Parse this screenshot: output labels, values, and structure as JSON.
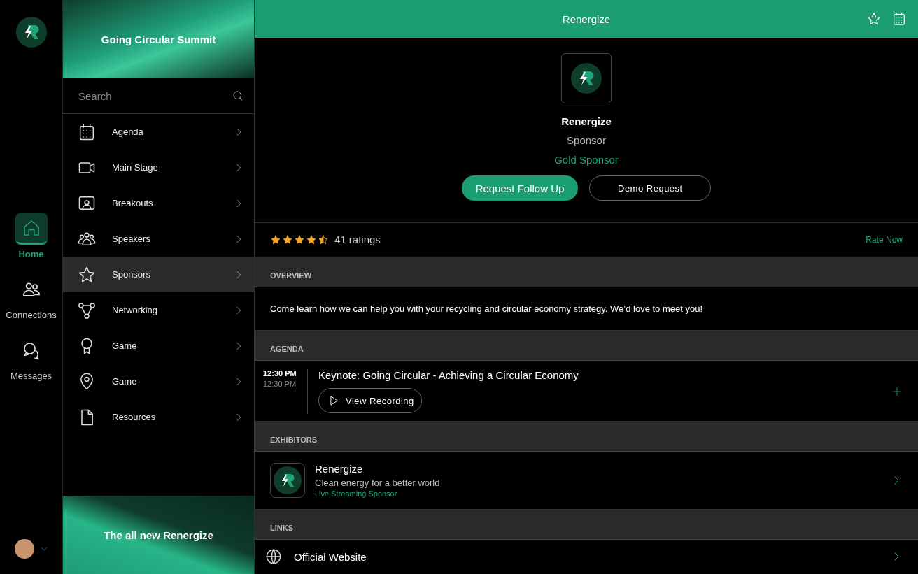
{
  "rail": {
    "items": [
      {
        "label": "Home",
        "kind": "home",
        "selected": true
      },
      {
        "label": "Connections",
        "kind": "people",
        "selected": false
      },
      {
        "label": "Messages",
        "kind": "chat",
        "selected": false
      }
    ]
  },
  "menu": {
    "banner_title": "Going Circular Summit",
    "search": {
      "placeholder": "Search"
    },
    "items": [
      {
        "label": "Agenda",
        "kind": "calendar",
        "selected": false
      },
      {
        "label": "Main Stage",
        "kind": "video",
        "selected": false
      },
      {
        "label": "Breakouts",
        "kind": "screen",
        "selected": false
      },
      {
        "label": "Speakers",
        "kind": "group",
        "selected": false
      },
      {
        "label": "Sponsors",
        "kind": "star",
        "selected": true
      },
      {
        "label": "Networking",
        "kind": "network",
        "selected": false
      },
      {
        "label": "Game",
        "kind": "medal",
        "selected": false
      },
      {
        "label": "Game",
        "kind": "pin",
        "selected": false
      },
      {
        "label": "Resources",
        "kind": "file",
        "selected": false
      }
    ],
    "footer_title": "The all new Renergize"
  },
  "header": {
    "title": "Renergize"
  },
  "sponsor": {
    "name": "Renergize",
    "role": "Sponsor",
    "tier": "Gold Sponsor",
    "buttons": [
      {
        "label": "Request Follow Up",
        "kind": "primary"
      },
      {
        "label": "Demo Request",
        "kind": "outline"
      }
    ]
  },
  "rating": {
    "stars": 4.5,
    "count": "41 ratings",
    "action": "Rate Now"
  },
  "overview": {
    "heading": "OVERVIEW",
    "text": "Come learn how we can help you with your recycling and circular economy strategy. We’d love to meet you!"
  },
  "agenda": {
    "heading": "AGENDA",
    "sessions": [
      {
        "start": "12:30 PM",
        "end": "12:30 PM",
        "title": "Keynote: Going Circular - Achieving a Circular Economy",
        "button": "View Recording"
      }
    ]
  },
  "exhibitors": {
    "heading": "EXHIBITORS",
    "items": [
      {
        "name": "Renergize",
        "tagline": "Clean energy for a better world",
        "tier": "Live Streaming Sponsor"
      }
    ]
  },
  "links": {
    "heading": "LINKS",
    "items": [
      {
        "label": "Official Website"
      }
    ]
  }
}
